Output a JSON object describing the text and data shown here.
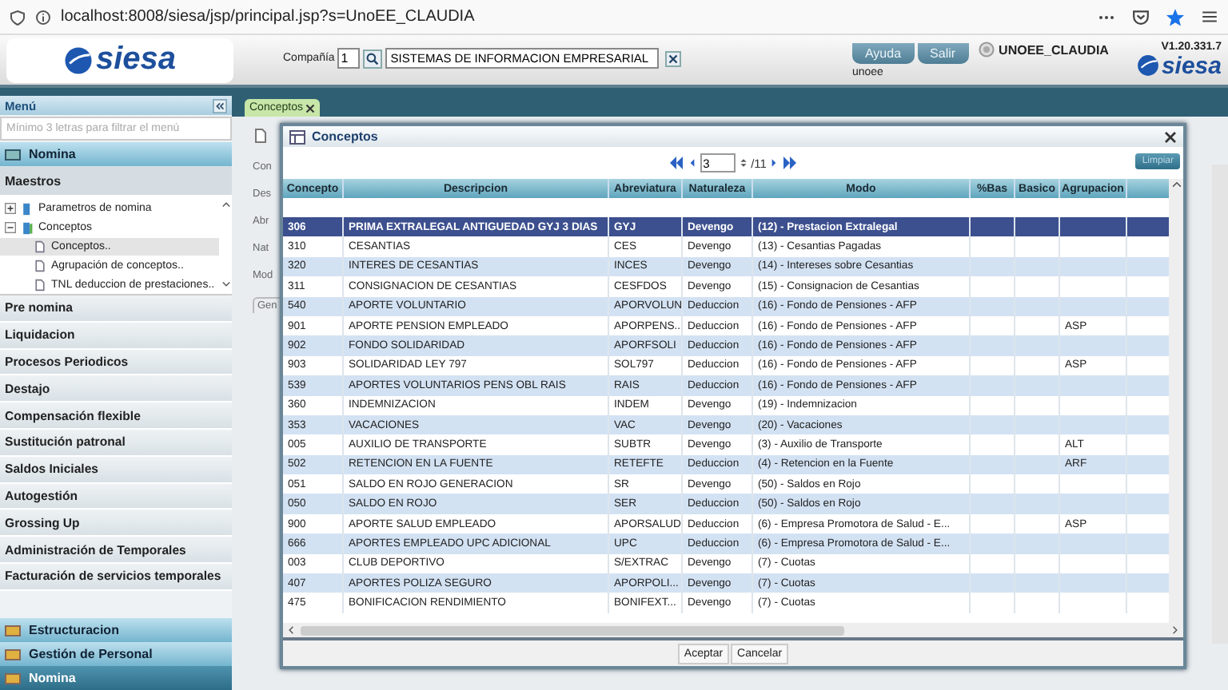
{
  "browser": {
    "url": "localhost:8008/siesa/jsp/principal.jsp?s=UnoEE_CLAUDIA"
  },
  "header": {
    "logo": "siesa",
    "company_label": "Compañía",
    "company_code": "1",
    "company_name": "SISTEMAS DE INFORMACION EMPRESARIAL",
    "buttons": [
      "Ayuda",
      "Salir"
    ],
    "user": "UNOEE_CLAUDIA",
    "database": "unoee",
    "version": "V1.20.331.7",
    "logo_right": "siesa"
  },
  "sidebar": {
    "title": "Menú",
    "search": {
      "placeholder": "Mínimo 3 letras para filtrar el menú"
    },
    "module": "Nomina",
    "group": "Maestros",
    "tree": [
      {
        "label": "Parametros de nomina",
        "expanded": false
      },
      {
        "label": "Conceptos",
        "expanded": true,
        "children": [
          {
            "label": "Conceptos..",
            "selected": true
          },
          {
            "label": "Agrupación de conceptos..",
            "selected": false
          },
          {
            "label": "TNL deduccion de prestaciones..",
            "selected": false
          }
        ]
      }
    ],
    "sections": [
      "Pre nomina",
      "Liquidacion",
      "Procesos Periodicos",
      "Destajo",
      "Compensación flexible",
      "Sustitución patronal",
      "Saldos Iniciales",
      "Autogestión",
      "Grossing Up",
      "Administración de Temporales",
      "Facturación de servicios temporales"
    ],
    "modules": [
      {
        "label": "Estructuracion",
        "selected": false
      },
      {
        "label": "Gestión de Personal",
        "selected": false
      },
      {
        "label": "Nomina",
        "selected": true
      }
    ]
  },
  "tabs": [
    {
      "label": "Conceptos",
      "selected": true
    }
  ],
  "form": {
    "labels": [
      "Con",
      "Des",
      "Abr",
      "Nat",
      "Mod"
    ],
    "tab": "Gen"
  },
  "dialog": {
    "title": "Conceptos",
    "page": "3",
    "pages": "/11",
    "clear_button": "Limpiar",
    "columns": [
      "Concepto",
      "Descripcion",
      "Abreviatura",
      "Naturaleza",
      "Modo",
      "%Bas",
      "Basico",
      "Agrupacion"
    ],
    "rows": [
      {
        "concepto": "306",
        "descripcion": "PRIMA EXTRALEGAL ANTIGUEDAD GYJ 3 DIAS",
        "abreviatura": "GYJ",
        "naturaleza": "Devengo",
        "modo": "(12) - Prestacion Extralegal",
        "selected": true
      },
      {
        "concepto": "310",
        "descripcion": "CESANTIAS",
        "abreviatura": "CES",
        "naturaleza": "Devengo",
        "modo": "(13) - Cesantias Pagadas",
        "selected": false
      },
      {
        "concepto": "320",
        "descripcion": "INTERES DE CESANTIAS",
        "abreviatura": "INCES",
        "naturaleza": "Devengo",
        "modo": "(14) - Intereses sobre Cesantias",
        "selected": false
      },
      {
        "concepto": "311",
        "descripcion": "CONSIGNACION DE CESANTIAS",
        "abreviatura": "CESFDOS",
        "naturaleza": "Devengo",
        "modo": "(15) - Consignacion de Cesantias",
        "selected": false
      },
      {
        "concepto": "540",
        "descripcion": "APORTE VOLUNTARIO",
        "abreviatura": "APORVOLUN",
        "naturaleza": "Deduccion",
        "modo": "(16) - Fondo de Pensiones - AFP",
        "selected": false
      },
      {
        "concepto": "901",
        "descripcion": "APORTE PENSION EMPLEADO",
        "abreviatura": "APORPENS...",
        "naturaleza": "Deduccion",
        "modo": "(16) - Fondo de Pensiones - AFP",
        "agrupacion": "ASP",
        "selected": false
      },
      {
        "concepto": "902",
        "descripcion": "FONDO SOLIDARIDAD",
        "abreviatura": "APORFSOLI",
        "naturaleza": "Deduccion",
        "modo": "(16) - Fondo de Pensiones - AFP",
        "selected": false
      },
      {
        "concepto": "903",
        "descripcion": "SOLIDARIDAD LEY 797",
        "abreviatura": "SOL797",
        "naturaleza": "Deduccion",
        "modo": "(16) - Fondo de Pensiones - AFP",
        "agrupacion": "ASP",
        "selected": false
      },
      {
        "concepto": "539",
        "descripcion": "APORTES VOLUNTARIOS PENS OBL RAIS",
        "abreviatura": "RAIS",
        "naturaleza": "Deduccion",
        "modo": "(16) - Fondo de Pensiones - AFP",
        "selected": false
      },
      {
        "concepto": "360",
        "descripcion": "INDEMNIZACION",
        "abreviatura": "INDEM",
        "naturaleza": "Devengo",
        "modo": "(19) - Indemnizacion",
        "selected": false
      },
      {
        "concepto": "353",
        "descripcion": "VACACIONES",
        "abreviatura": "VAC",
        "naturaleza": "Devengo",
        "modo": "(20) - Vacaciones",
        "selected": false
      },
      {
        "concepto": "005",
        "descripcion": "AUXILIO DE TRANSPORTE",
        "abreviatura": "SUBTR",
        "naturaleza": "Devengo",
        "modo": "(3) - Auxilio de Transporte",
        "agrupacion": "ALT",
        "selected": false
      },
      {
        "concepto": "502",
        "descripcion": "RETENCION EN LA FUENTE",
        "abreviatura": "RETEFTE",
        "naturaleza": "Deduccion",
        "modo": "(4) - Retencion en la Fuente",
        "agrupacion": "ARF",
        "selected": false
      },
      {
        "concepto": "051",
        "descripcion": "SALDO EN ROJO GENERACION",
        "abreviatura": "SR",
        "naturaleza": "Devengo",
        "modo": "(50) - Saldos en Rojo",
        "selected": false
      },
      {
        "concepto": "050",
        "descripcion": "SALDO EN ROJO",
        "abreviatura": "SER",
        "naturaleza": "Deduccion",
        "modo": "(50) - Saldos en Rojo",
        "selected": false
      },
      {
        "concepto": "900",
        "descripcion": "APORTE SALUD EMPLEADO",
        "abreviatura": "APORSALUD",
        "naturaleza": "Deduccion",
        "modo": "(6) - Empresa Promotora de Salud - E...",
        "agrupacion": "ASP",
        "selected": false
      },
      {
        "concepto": "666",
        "descripcion": "APORTES EMPLEADO UPC ADICIONAL",
        "abreviatura": "UPC",
        "naturaleza": "Deduccion",
        "modo": "(6) - Empresa Promotora de Salud - E...",
        "selected": false
      },
      {
        "concepto": "003",
        "descripcion": "CLUB DEPORTIVO",
        "abreviatura": "S/EXTRAC",
        "naturaleza": "Devengo",
        "modo": "(7) - Cuotas",
        "selected": false
      },
      {
        "concepto": "407",
        "descripcion": "APORTES POLIZA SEGURO",
        "abreviatura": "APORPOLI...",
        "naturaleza": "Devengo",
        "modo": "(7) - Cuotas",
        "selected": false
      },
      {
        "concepto": "475",
        "descripcion": "BONIFICACION RENDIMIENTO",
        "abreviatura": "BONIFEXT...",
        "naturaleza": "Devengo",
        "modo": "(7) - Cuotas",
        "selected": false
      }
    ],
    "buttons": [
      "Aceptar",
      "Cancelar"
    ]
  }
}
